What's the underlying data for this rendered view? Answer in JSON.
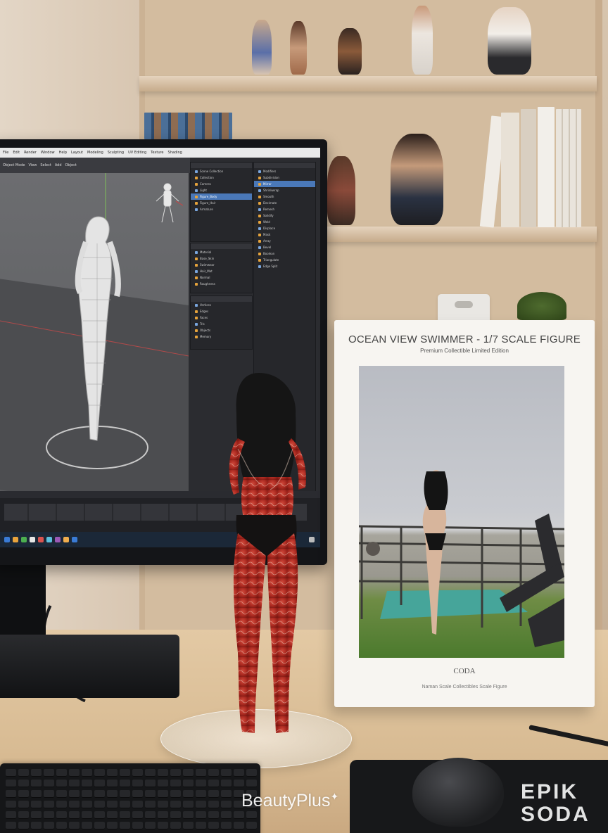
{
  "scene": {
    "description_free": true
  },
  "monitor": {
    "menubar": [
      "File",
      "Edit",
      "Render",
      "Window",
      "Help",
      "Layout",
      "Modeling",
      "Sculpting",
      "UV Editing",
      "Texture",
      "Shading"
    ],
    "toolbar": [
      "Object Mode",
      "View",
      "Select",
      "Add",
      "Object"
    ],
    "outliner_top": [
      "Scene Collection",
      "Collection",
      "Camera",
      "Light",
      "Figure_Body",
      "Figure_Hair",
      "Armature"
    ],
    "outliner_mid": [
      "Material",
      "Base_Skin",
      "Swimwear",
      "Hair_Mat",
      "Normal",
      "Roughness"
    ],
    "properties_list": [
      "Modifiers",
      "Subdivision",
      "Mirror",
      "Shrinkwrap",
      "Smooth",
      "Decimate",
      "Remesh",
      "Solidify",
      "Weld",
      "Displace",
      "Mask",
      "Array",
      "Bevel",
      "Boolean",
      "Triangulate",
      "Edge Split"
    ],
    "small_list": [
      "Vertices",
      "Edges",
      "Faces",
      "Tris",
      "Objects",
      "Memory"
    ]
  },
  "box": {
    "title": "OCEAN VIEW SWIMMER - 1/7 SCALE FIGURE",
    "subtitle": "Premium Collectible  Limited Edition",
    "brand": "CODA",
    "brand_sub": "Naman Scale Collectibles  Scale Figure"
  },
  "watermark": {
    "text": "BeautyPlus",
    "sparkle": "✦",
    "logo_top": "EPIK",
    "logo_bottom": "SODA"
  },
  "colors": {
    "wall": "#d7c4ad",
    "desk": "#e3c9a4",
    "screen": "#2b2c30",
    "selection": "#4a78b8",
    "figure_red": "#b3312a"
  }
}
